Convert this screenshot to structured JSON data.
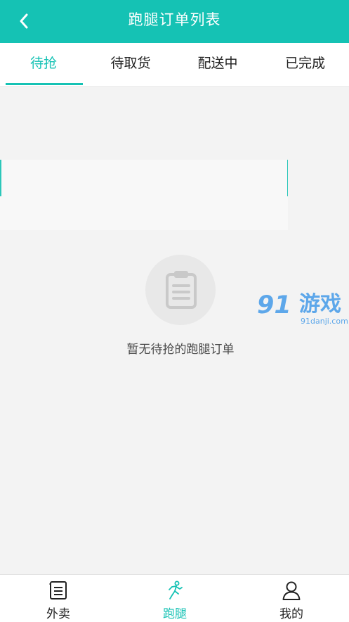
{
  "header": {
    "title": "跑腿订单列表",
    "back_icon": "chevron-left-icon",
    "background": "#15c2b4"
  },
  "tabs": [
    {
      "label": "待抢",
      "active": true
    },
    {
      "label": "待取货",
      "active": false
    },
    {
      "label": "配送中",
      "active": false
    },
    {
      "label": "已完成",
      "active": false
    }
  ],
  "empty_state": {
    "icon": "clipboard-icon",
    "message": "暂无待抢的跑腿订单"
  },
  "watermark": {
    "number": "91",
    "text": "游戏",
    "domain": "91danji.com"
  },
  "bottom_nav": [
    {
      "label": "外卖",
      "icon": "order-list-icon",
      "active": false
    },
    {
      "label": "跑腿",
      "icon": "runner-icon",
      "active": true
    },
    {
      "label": "我的",
      "icon": "profile-icon",
      "active": false
    }
  ],
  "colors": {
    "accent": "#15c2b4",
    "background": "#f3f3f3",
    "text": "#222222"
  }
}
